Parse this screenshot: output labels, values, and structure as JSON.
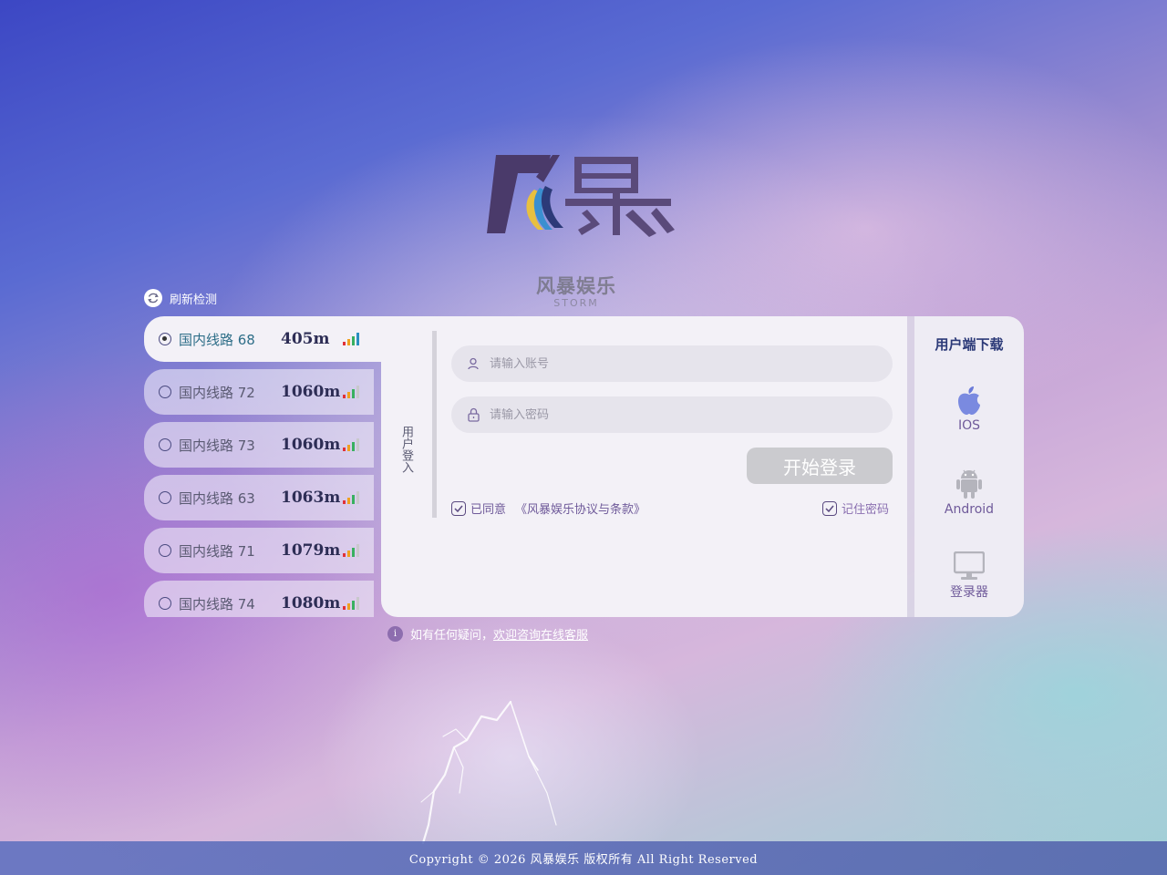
{
  "brand": {
    "logo_text": "风暴",
    "name": "风暴娱乐",
    "subtitle": "STORM"
  },
  "refresh": {
    "label": "刷新检测",
    "icon": "refresh-icon"
  },
  "routes": [
    {
      "name": "国内线路 68",
      "ping": "405m",
      "selected": true
    },
    {
      "name": "国内线路 72",
      "ping": "1060m",
      "selected": false
    },
    {
      "name": "国内线路 73",
      "ping": "1060m",
      "selected": false
    },
    {
      "name": "国内线路 63",
      "ping": "1063m",
      "selected": false
    },
    {
      "name": "国内线路 71",
      "ping": "1079m",
      "selected": false
    },
    {
      "name": "国内线路 74",
      "ping": "1080m",
      "selected": false
    }
  ],
  "login": {
    "side_tab": "用户登入",
    "account_placeholder": "请输入账号",
    "password_placeholder": "请输入密码",
    "submit_label": "开始登录",
    "agree_label": "已同意",
    "agree_link": "《风暴娱乐协议与条款》",
    "remember_label": "记住密码"
  },
  "download": {
    "title": "用户端下载",
    "items": [
      {
        "label": "IOS",
        "icon": "apple-icon"
      },
      {
        "label": "Android",
        "icon": "android-icon"
      },
      {
        "label": "登录器",
        "icon": "monitor-icon"
      }
    ]
  },
  "help": {
    "text": "如有任何疑问，",
    "link": "欢迎咨询在线客服"
  },
  "footer": {
    "copyright": "Copyright © 2026 风暴娱乐 版权所有 All Right Reserved"
  },
  "colors": {
    "accent": "#6f5a9a",
    "selected_route": "#2e6e88",
    "signal": [
      "#e0323a",
      "#f0a020",
      "#38b060",
      "#2a90c0"
    ]
  }
}
